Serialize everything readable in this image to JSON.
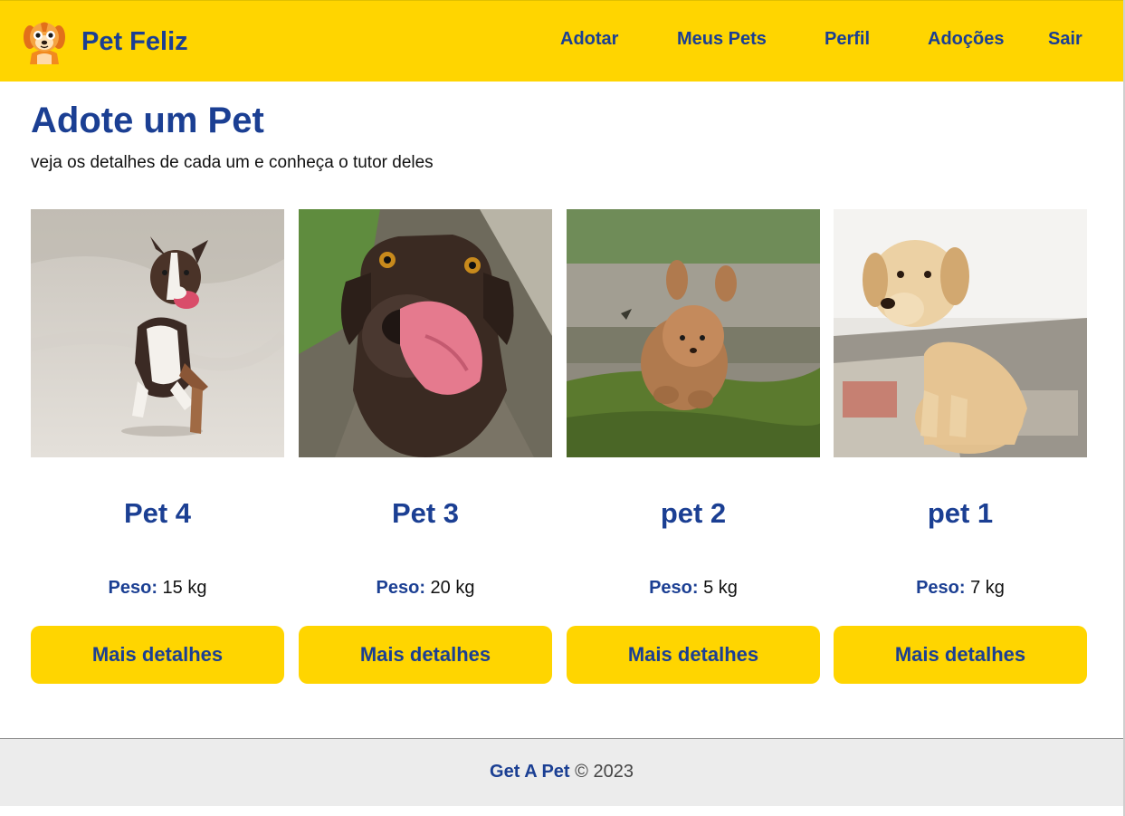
{
  "brand": {
    "name": "Pet Feliz",
    "logo_icon": "dog-face-icon"
  },
  "nav": {
    "items": [
      {
        "label": "Adotar"
      },
      {
        "label": "Meus Pets"
      },
      {
        "label": "Perfil"
      },
      {
        "label": "Adoções"
      },
      {
        "label": "Sair"
      }
    ]
  },
  "main": {
    "title": "Adote um Pet",
    "subtitle": "veja os detalhes de cada um e conheça o tutor deles"
  },
  "pets": [
    {
      "name": "Pet 4",
      "weight_label": "Peso:",
      "weight_value": "15 kg",
      "button_label": "Mais detalhes",
      "photo": "running-tricolor-dog-on-sand"
    },
    {
      "name": "Pet 3",
      "weight_label": "Peso:",
      "weight_value": "20 kg",
      "button_label": "Mais detalhes",
      "photo": "chocolate-labrador-licking-nose"
    },
    {
      "name": "pet 2",
      "weight_label": "Peso:",
      "weight_value": "5 kg",
      "button_label": "Mais detalhes",
      "photo": "jumping-poodle-puppy-on-grass"
    },
    {
      "name": "pet 1",
      "weight_label": "Peso:",
      "weight_value": "7 kg",
      "button_label": "Mais detalhes",
      "photo": "sitting-yellow-labrador-puppy"
    }
  ],
  "footer": {
    "brand": "Get A Pet",
    "copyright": "© 2023"
  },
  "colors": {
    "accent_yellow": "#FFD500",
    "brand_blue": "#1b3f93",
    "footer_bg": "#ececec"
  }
}
